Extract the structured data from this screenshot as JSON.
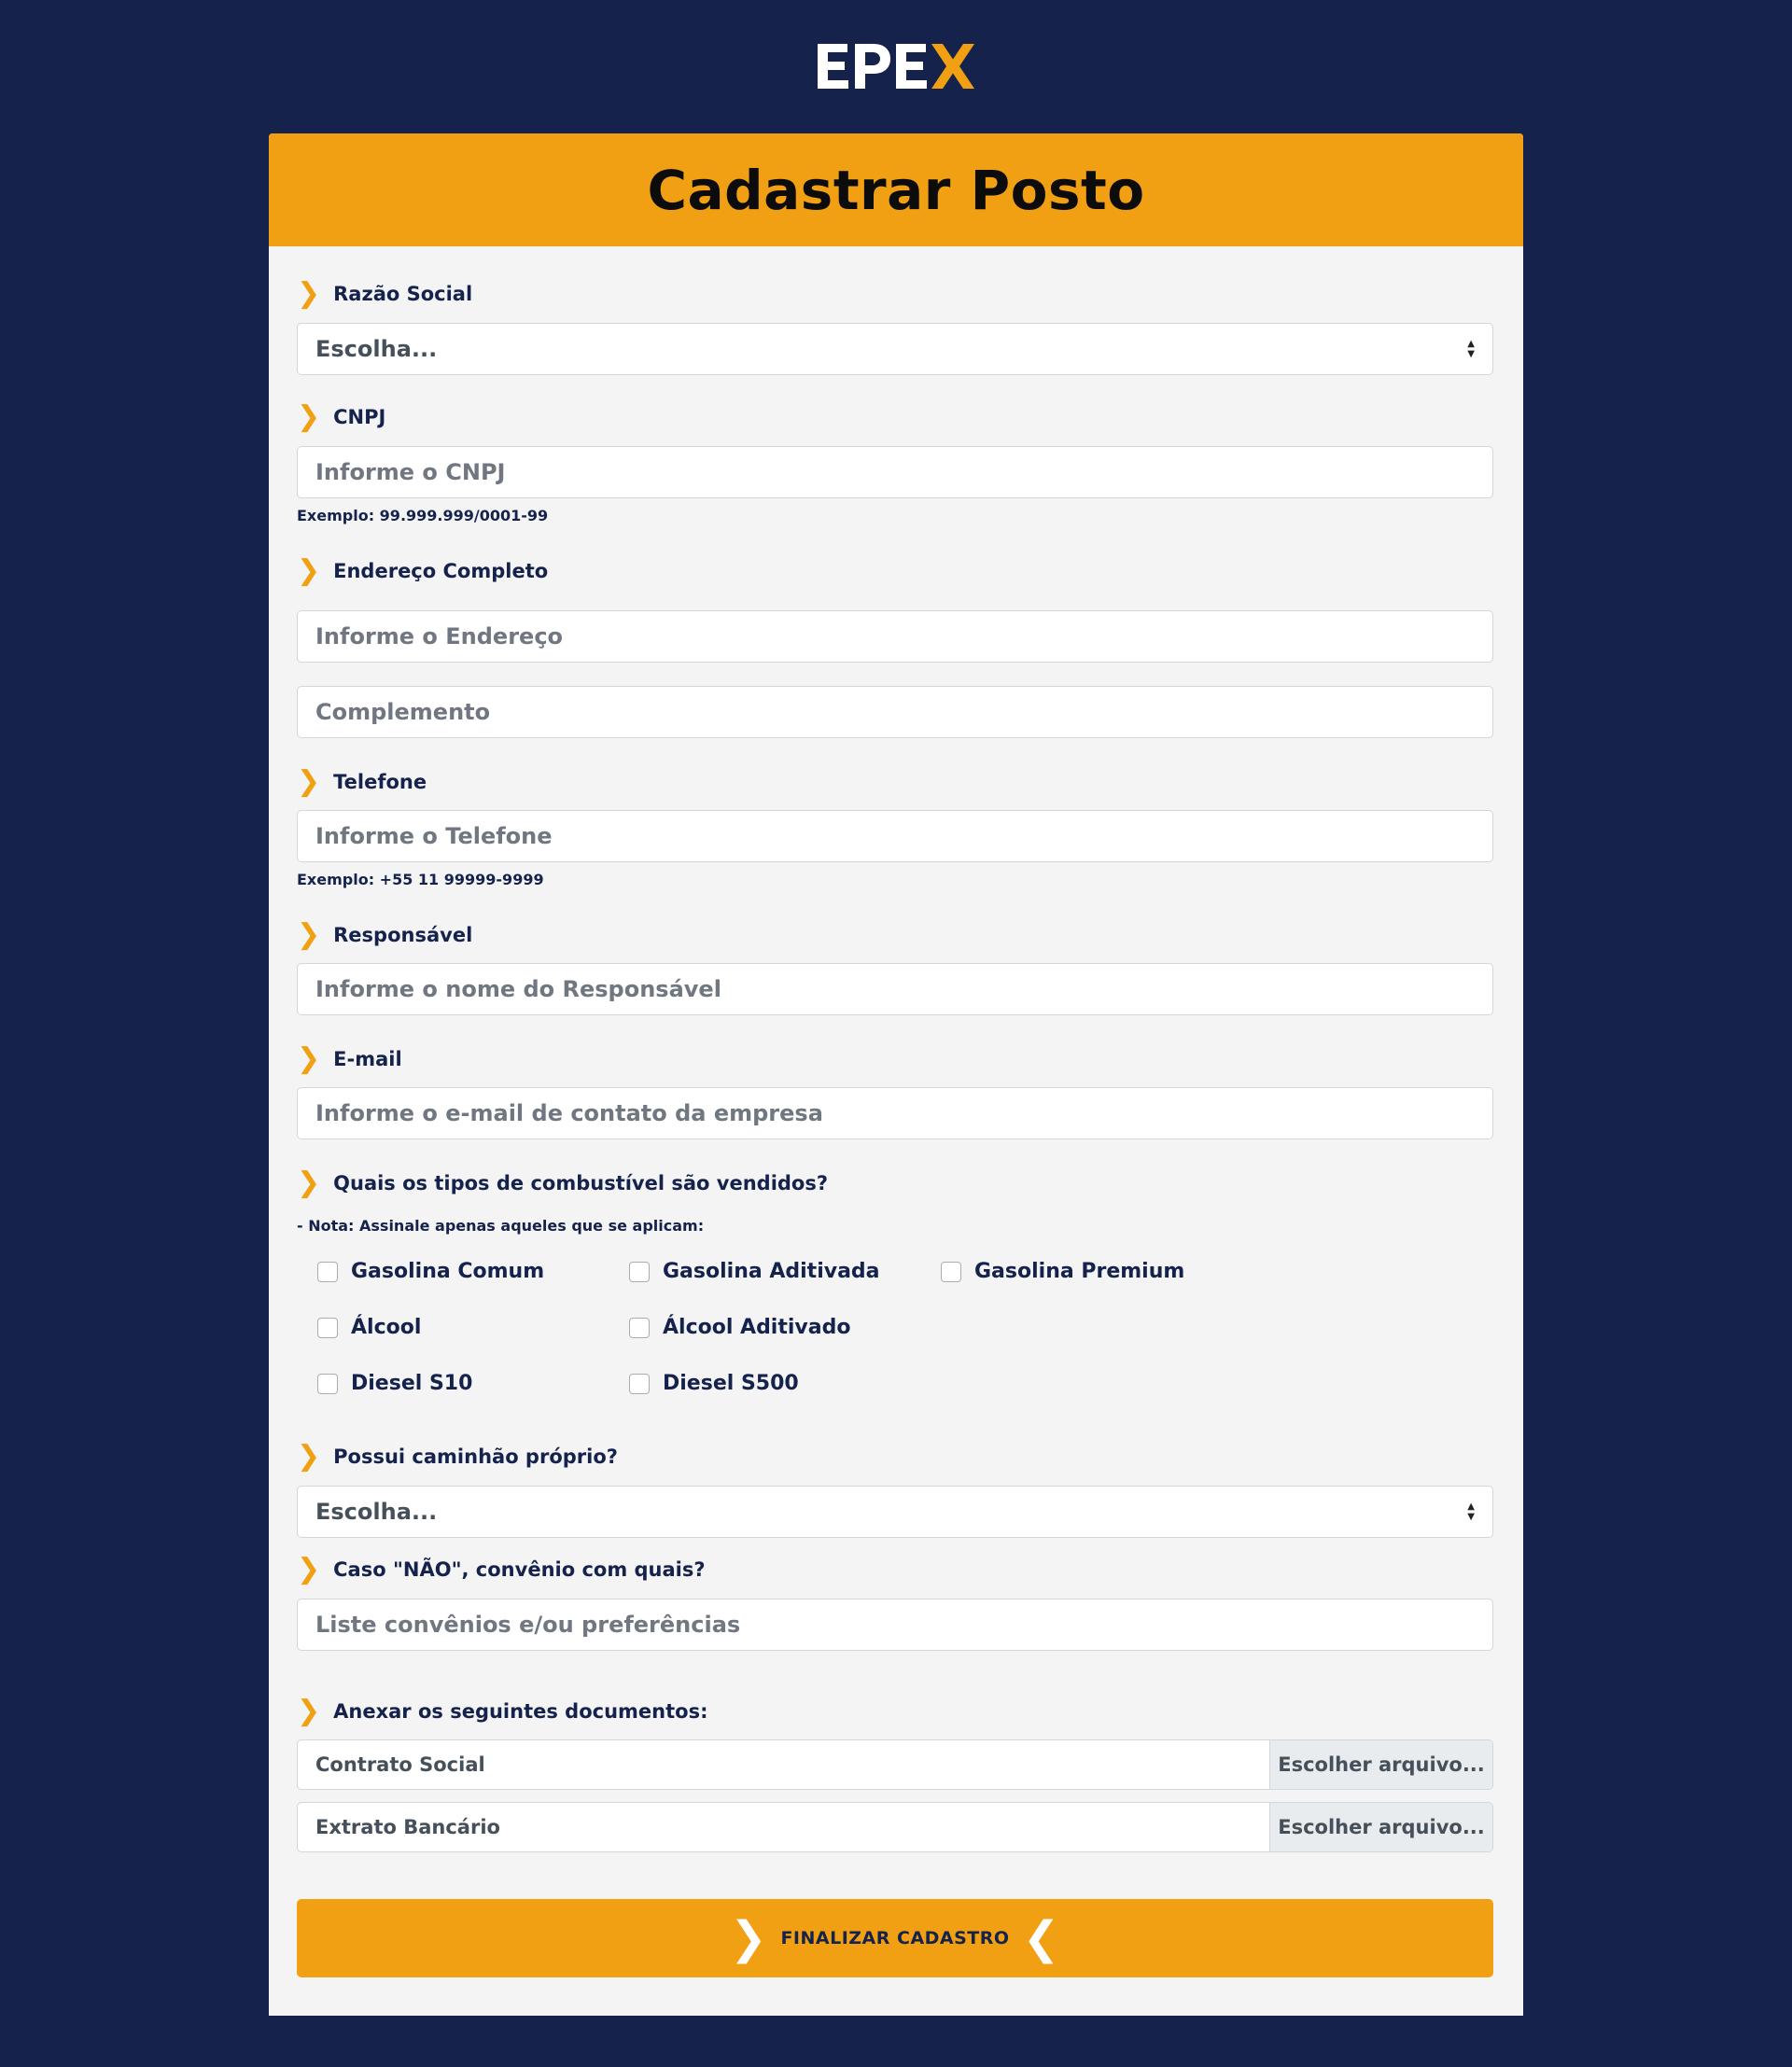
{
  "brand": {
    "logo_text": "EPEX",
    "colors": {
      "background": "#14224c",
      "accent": "#f0a012",
      "card": "#f4f4f4"
    }
  },
  "page": {
    "title": "Cadastrar Posto"
  },
  "form": {
    "razao_social": {
      "label": "Razão Social",
      "selected": "Escolha..."
    },
    "cnpj": {
      "label": "CNPJ",
      "placeholder": "Informe o CNPJ",
      "hint": "Exemplo: 99.999.999/0001-99"
    },
    "endereco": {
      "label": "Endereço Completo",
      "placeholder": "Informe o Endereço",
      "complemento_placeholder": "Complemento"
    },
    "telefone": {
      "label": "Telefone",
      "placeholder": "Informe o Telefone",
      "hint": "Exemplo: +55 11 99999-9999"
    },
    "responsavel": {
      "label": "Responsável",
      "placeholder": "Informe o nome do Responsável"
    },
    "email": {
      "label": "E-mail",
      "placeholder": "Informe o e-mail de contato da empresa"
    },
    "combustiveis": {
      "label": "Quais os tipos de combustível são vendidos?",
      "note": "- Nota: Assinale apenas aqueles que se aplicam:",
      "options": [
        "Gasolina Comum",
        "Gasolina Aditivada",
        "Gasolina Premium",
        "Álcool",
        "Álcool Aditivado",
        "Diesel S10",
        "Diesel S500"
      ]
    },
    "caminhao": {
      "label": "Possui caminhão próprio?",
      "selected": "Escolha..."
    },
    "convenio": {
      "label": "Caso \"NÃO\", convênio com quais?",
      "placeholder": "Liste convênios e/ou preferências"
    },
    "documentos": {
      "label": "Anexar os seguintes documentos:",
      "files": [
        {
          "name": "Contrato Social",
          "button": "Escolher arquivo..."
        },
        {
          "name": "Extrato Bancário",
          "button": "Escolher arquivo..."
        }
      ]
    },
    "submit_label": "FINALIZAR CADASTRO"
  }
}
